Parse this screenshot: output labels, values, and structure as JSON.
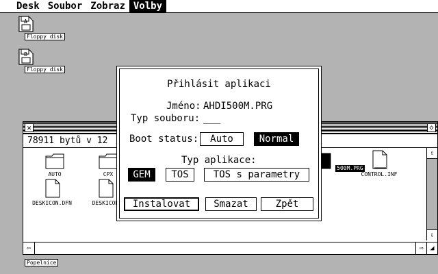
{
  "menu": {
    "items": [
      {
        "label": "Desk"
      },
      {
        "label": "Soubor"
      },
      {
        "label": "Zobraz"
      },
      {
        "label": "Volby",
        "active": true
      }
    ]
  },
  "desktop": {
    "icons": [
      {
        "label": "Floppy disk"
      },
      {
        "label": "Floppy disk"
      }
    ],
    "trash_label": "Popelnice"
  },
  "window": {
    "info": "78911 bytů v 12",
    "files": [
      {
        "name": "AUTO",
        "type": "folder"
      },
      {
        "name": "CPX",
        "type": "folder"
      },
      {
        "name": "500M.PRG",
        "type": "program",
        "selected": true
      },
      {
        "name": "CONTROL.INF",
        "type": "document"
      },
      {
        "name": "DESKICON.DFN",
        "type": "document"
      },
      {
        "name": "DESKICON",
        "type": "document"
      }
    ]
  },
  "dialog": {
    "title": "Přihlásit aplikaci",
    "name_label": "Jméno:",
    "name_value": "AHDI500M.PRG",
    "filetype_label": "Typ souboru:",
    "filetype_value": "___",
    "boot_label": "Boot status:",
    "boot_options": [
      {
        "label": "Auto",
        "selected": false
      },
      {
        "label": "Normal",
        "selected": true
      }
    ],
    "apptype_label": "Typ aplikace:",
    "app_types": [
      {
        "label": "GEM",
        "selected": true
      },
      {
        "label": "TOS",
        "selected": false
      },
      {
        "label": "TOS s parametry",
        "selected": false
      }
    ],
    "buttons": {
      "install": "Instalovat",
      "delete": "Smazat",
      "back": "Zpět"
    }
  }
}
